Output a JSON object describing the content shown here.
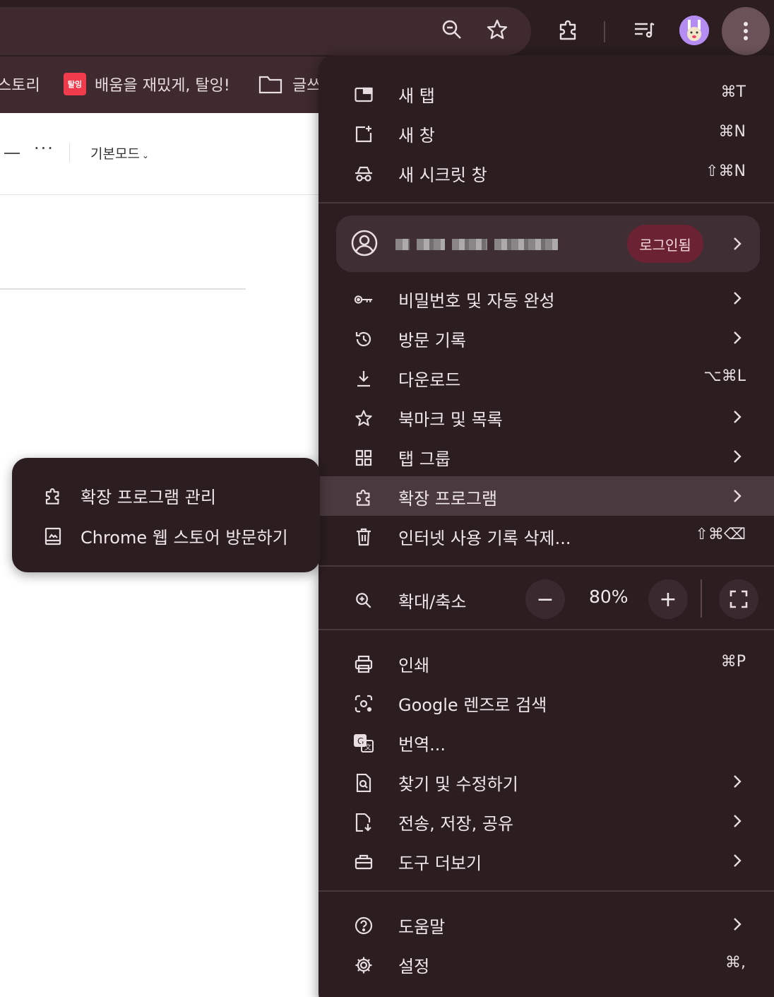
{
  "bookmarks": [
    {
      "label": "스토리"
    },
    {
      "label": "배움을 재밌게, 탈잉!",
      "logo_text": "탈잉"
    },
    {
      "label": "글쓰"
    }
  ],
  "page": {
    "mode_label": "기본모드",
    "more_label": "···"
  },
  "menu": {
    "new_tab": {
      "label": "새 탭",
      "shortcut": "⌘T"
    },
    "new_window": {
      "label": "새 창",
      "shortcut": "⌘N"
    },
    "incognito": {
      "label": "새 시크릿 창",
      "shortcut": "⇧⌘N"
    },
    "profile": {
      "name": "[blurred]",
      "badge": "로그인됨"
    },
    "passwords": {
      "label": "비밀번호 및 자동 완성"
    },
    "history": {
      "label": "방문 기록"
    },
    "downloads": {
      "label": "다운로드",
      "shortcut": "⌥⌘L"
    },
    "bookmarks": {
      "label": "북마크 및 목록"
    },
    "tab_groups": {
      "label": "탭 그룹"
    },
    "extensions": {
      "label": "확장 프로그램"
    },
    "clear_data": {
      "label": "인터넷 사용 기록 삭제...",
      "shortcut": "⇧⌘⌫"
    },
    "zoom": {
      "label": "확대/축소",
      "value": "80%",
      "minus": "−",
      "plus": "+"
    },
    "print": {
      "label": "인쇄",
      "shortcut": "⌘P"
    },
    "lens": {
      "label": "Google 렌즈로 검색"
    },
    "translate": {
      "label": "번역..."
    },
    "find": {
      "label": "찾기 및 수정하기"
    },
    "share": {
      "label": "전송, 저장, 공유"
    },
    "more_tools": {
      "label": "도구 더보기"
    },
    "help": {
      "label": "도움말"
    },
    "settings": {
      "label": "설정",
      "shortcut": "⌘,"
    }
  },
  "submenu": {
    "manage": {
      "label": "확장 프로그램 관리"
    },
    "store": {
      "label": "Chrome 웹 스토어 방문하기"
    }
  },
  "colors": {
    "menu_bg": "#2b1d20",
    "highlight": "#4a3a3f",
    "badge_bg": "#6b2333",
    "toolbar": "#2b1d20"
  }
}
